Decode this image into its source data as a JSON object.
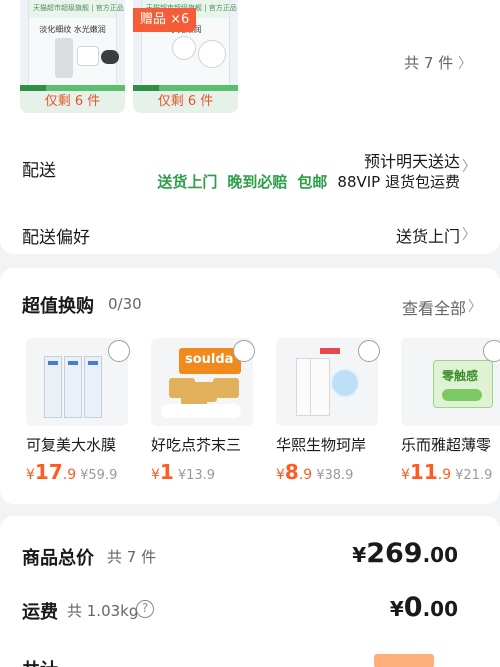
{
  "items": {
    "thumbs": [
      {
        "strip": "天猫超市超级旗舰 | 官方正品 极速送达",
        "title": "淡化细纹 水光嫩润",
        "remaining": "仅剩 6 件"
      },
      {
        "strip": "天猫超市超级旗舰 | 官方正品 极速送达",
        "title": "水光嫩润",
        "gift": "赠品 ×6",
        "remaining": "仅剩 6 件"
      }
    ],
    "count_label": "共 7 件"
  },
  "delivery": {
    "label": "配送",
    "time": "预计明天送达",
    "tags_green": [
      "送货上门",
      "晚到必赔",
      "包邮"
    ],
    "tag_vip": "88VIP 退货包运费"
  },
  "preference": {
    "label": "配送偏好",
    "value": "送货上门"
  },
  "exchange": {
    "title": "超值换购",
    "count": "0/30",
    "view_all": "查看全部",
    "products": [
      {
        "name": "可复美大水膜",
        "price_int": "17",
        "price_dec": ".9",
        "original": "¥59.9"
      },
      {
        "name": "好吃点芥末三",
        "price_int": "1",
        "price_dec": "",
        "original": "¥13.9",
        "brand": "soulda"
      },
      {
        "name": "华熙生物珂岸",
        "price_int": "8",
        "price_dec": ".9",
        "original": "¥38.9"
      },
      {
        "name": "乐而雅超薄零",
        "price_int": "11",
        "price_dec": ".9",
        "original": "¥21.9",
        "brand": "零触感"
      }
    ],
    "currency": "¥"
  },
  "summary": {
    "goods_label": "商品总价",
    "goods_count": "共 7 件",
    "goods_price_cur": "¥",
    "goods_price_int": "269",
    "goods_price_dec": ".00",
    "ship_label": "运费",
    "ship_weight": "共 1.03kg",
    "help_symbol": "?",
    "ship_price_cur": "¥",
    "ship_price_int": "0",
    "ship_price_dec": ".00",
    "total_label": "共计"
  },
  "colors": {
    "accent_orange": "#ff5a1f",
    "green": "#2e9e4a",
    "gift_red": "#f45d37"
  },
  "icons": {
    "chevron": "chevron-right-icon",
    "radio": "radio-unchecked-icon",
    "help": "question-circle-icon"
  }
}
